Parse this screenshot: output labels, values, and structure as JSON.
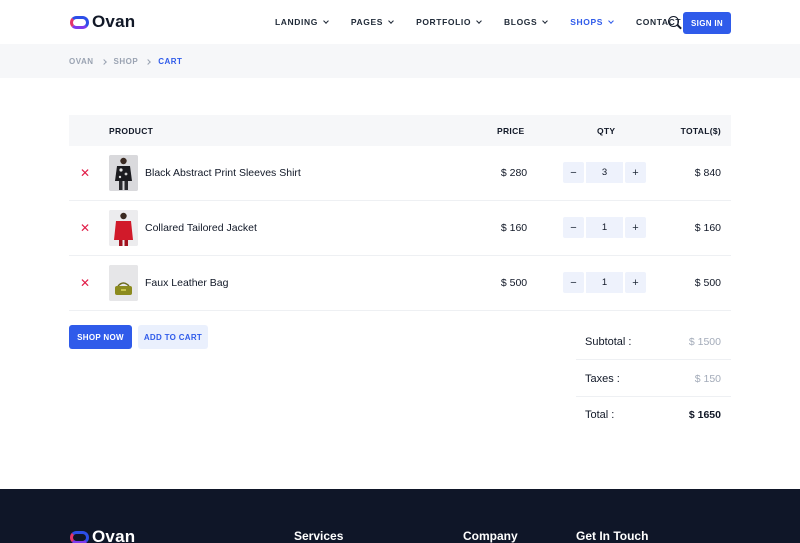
{
  "brand": {
    "name": "Ovan"
  },
  "nav": {
    "items": [
      {
        "label": "LANDING",
        "has_dropdown": true
      },
      {
        "label": "PAGES",
        "has_dropdown": true
      },
      {
        "label": "PORTFOLIO",
        "has_dropdown": true
      },
      {
        "label": "BLOGS",
        "has_dropdown": true
      },
      {
        "label": "SHOPS",
        "has_dropdown": true,
        "active": true
      },
      {
        "label": "CONTACT US",
        "has_dropdown": false
      }
    ],
    "signin_label": "SIGN IN"
  },
  "breadcrumb": {
    "items": [
      "OVAN",
      "SHOP",
      "CART"
    ]
  },
  "cart": {
    "headers": {
      "product": "PRODUCT",
      "price": "PRICE",
      "qty": "QTY",
      "total": "TOTAL($)"
    },
    "items": [
      {
        "name": "Black Abstract Print Sleeves Shirt",
        "price": "$ 280",
        "qty": "3",
        "total": "$ 840"
      },
      {
        "name": "Collared Tailored Jacket",
        "price": "$ 160",
        "qty": "1",
        "total": "$ 160"
      },
      {
        "name": "Faux Leather Bag",
        "price": "$ 500",
        "qty": "1",
        "total": "$ 500"
      }
    ],
    "remove_symbol": "✕",
    "minus_symbol": "−",
    "plus_symbol": "+"
  },
  "actions": {
    "shop_now": "SHOP NOW",
    "add_to_cart": "ADD TO CART"
  },
  "summary": {
    "subtotal_label": "Subtotal :",
    "subtotal_value": "$ 1500",
    "taxes_label": "Taxes :",
    "taxes_value": "$ 150",
    "total_label": "Total :",
    "total_value": "$ 1650"
  },
  "footer": {
    "brand": "Ovan",
    "columns": [
      "Services",
      "Company",
      "Get In Touch"
    ]
  },
  "colors": {
    "accent": "#2f5bea",
    "remove": "#e11d48",
    "footer_bg": "#0f1628"
  }
}
